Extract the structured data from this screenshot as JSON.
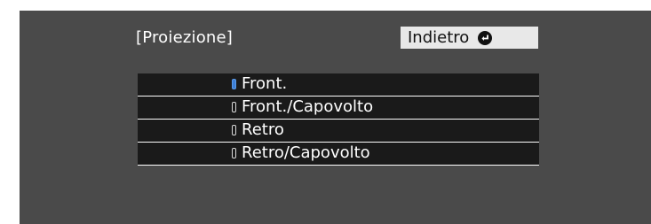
{
  "menu": {
    "title": "[Proiezione]",
    "back_label": "Indietro"
  },
  "options": [
    {
      "label": "Front.",
      "selected": true
    },
    {
      "label": "Front./Capovolto",
      "selected": false
    },
    {
      "label": "Retro",
      "selected": false
    },
    {
      "label": "Retro/Capovolto",
      "selected": false
    }
  ],
  "colors": {
    "panel_background": "#4a4a4a",
    "option_background": "#1a1a1a",
    "selected_marker": "#3d7fd6",
    "back_button_background": "#e8e8e8"
  },
  "icons": {
    "back": "return-arrow-icon"
  }
}
